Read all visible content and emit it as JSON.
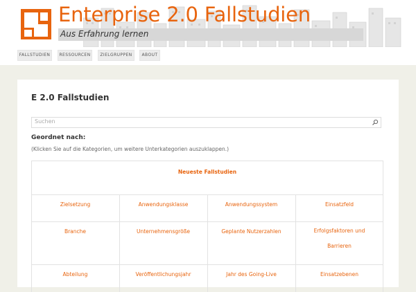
{
  "header": {
    "title": "Enterprise 2.0 Fallstudien",
    "tagline": "Aus Erfahrung lernen"
  },
  "nav": {
    "items": [
      {
        "label": "FALLSTUDIEN"
      },
      {
        "label": "RESSOURCEN"
      },
      {
        "label": "ZIELGRUPPEN"
      },
      {
        "label": "ABOUT"
      }
    ]
  },
  "main": {
    "title": "E 2.0 Fallstudien",
    "search_placeholder": "Suchen",
    "sort_label": "Geordnet nach:",
    "hint": "(Klicken Sie auf die Kategorien, um weitere Unterkategorien auszuklappen.)",
    "newest": "Neueste Fallstudien",
    "categories": [
      [
        "Zielsetzung",
        "Anwendungsklasse",
        "Anwendungssystem",
        "Einsatzfeld"
      ],
      [
        "Branche",
        "Unternehmensgröße",
        "Geplante Nutzerzahlen",
        "Erfolgsfaktoren und Barrieren"
      ],
      [
        "Abteilung",
        "Veröffentlichungsjahr",
        "Jahr des Going-Live",
        "Einsatzebenen"
      ]
    ]
  },
  "colors": {
    "accent": "#e8640e",
    "background": "#f0f0e8"
  }
}
